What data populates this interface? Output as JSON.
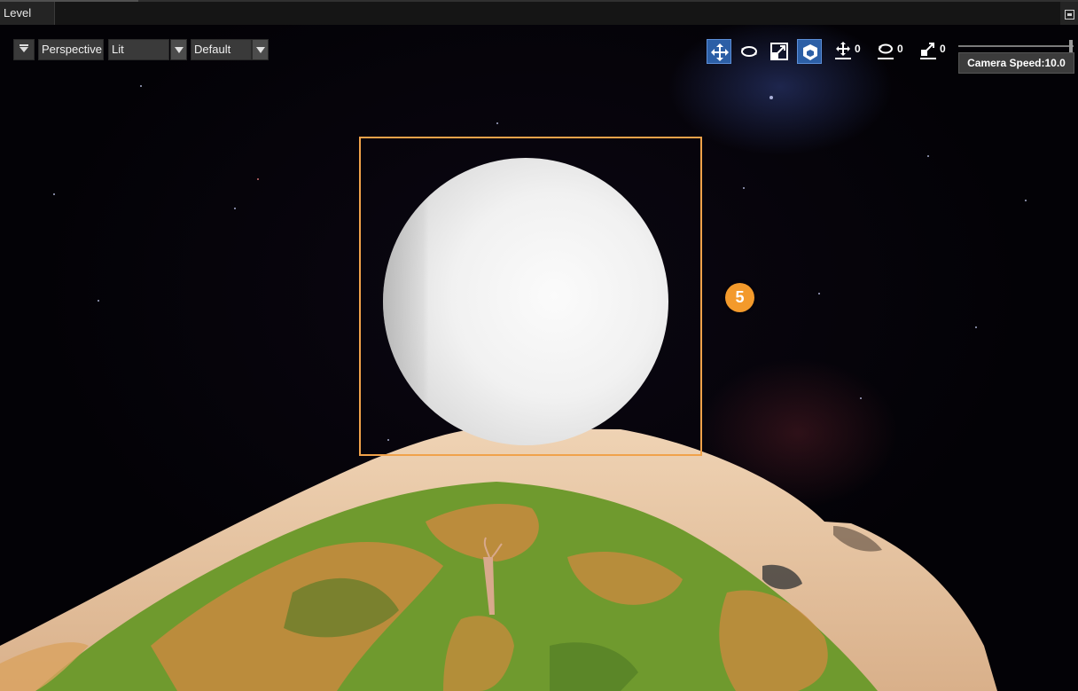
{
  "window": {
    "tab_title": "Level"
  },
  "toolbar": {
    "menu_icon": "dropdown-arrow-icon",
    "view_mode": "Perspective",
    "lighting_mode": "Lit",
    "preset": "Default",
    "tools": [
      {
        "name": "translate",
        "icon": "move-arrows-icon",
        "active": true
      },
      {
        "name": "rotate",
        "icon": "rotate-icon",
        "active": false
      },
      {
        "name": "scale",
        "icon": "scale-icon",
        "active": false
      },
      {
        "name": "world-space",
        "icon": "cube-icon",
        "active": true
      }
    ],
    "snap_translate": "0",
    "snap_rotate": "0",
    "snap_scale": "0",
    "camera_speed_label": "Camera Speed:10.0"
  },
  "viewport": {
    "selection_color": "#f0a24a",
    "annotation_badge": "5",
    "badge_color": "#f39a2c",
    "active_tool_color": "#2c5fa6"
  }
}
